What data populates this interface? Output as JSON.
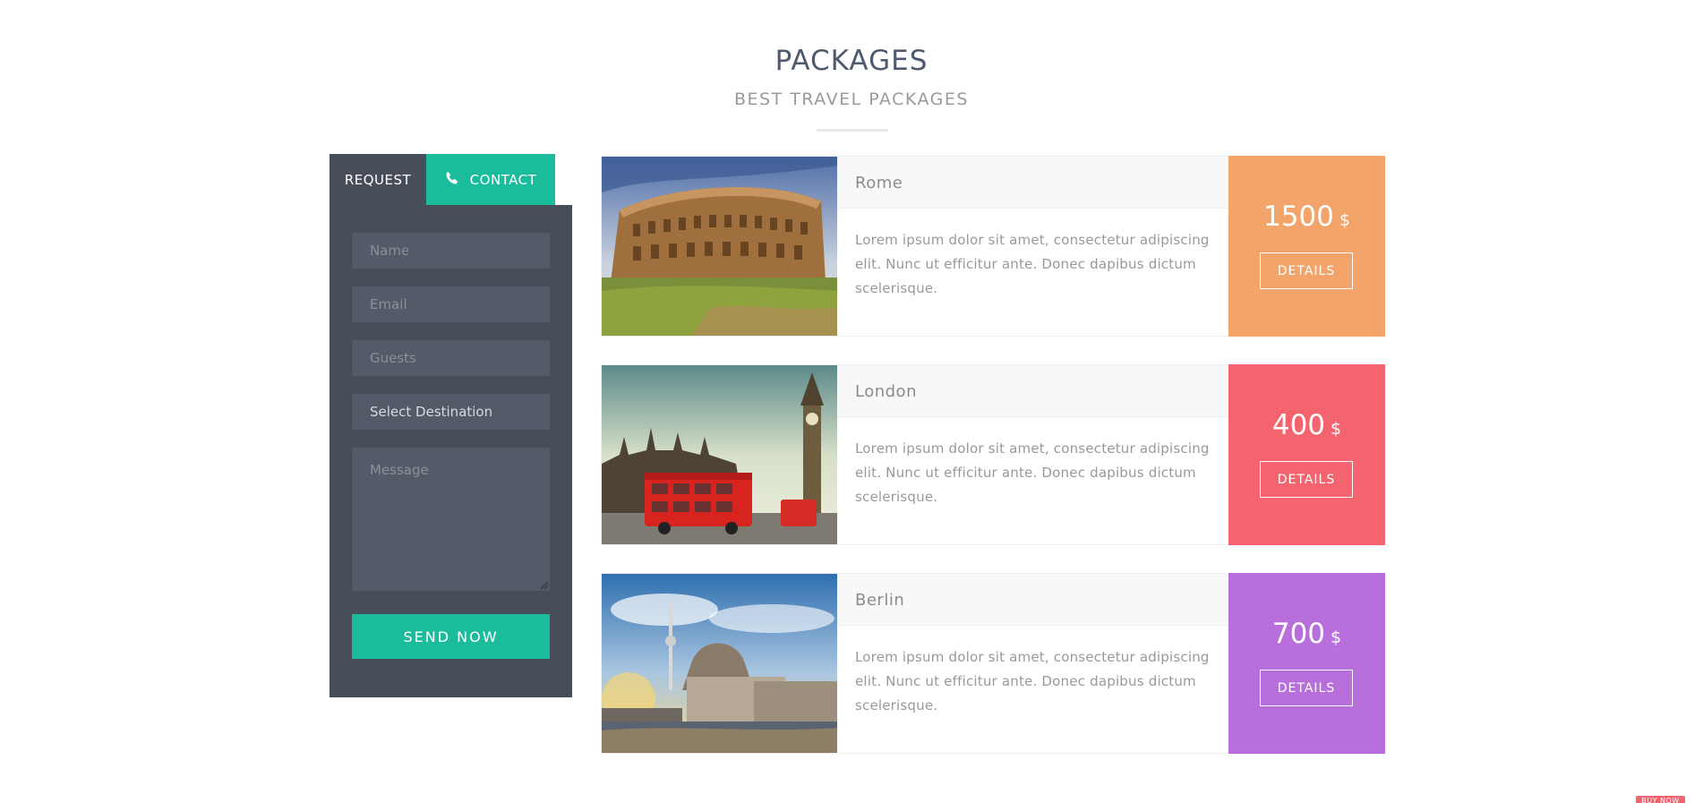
{
  "header": {
    "title": "PACKAGES",
    "subtitle": "BEST TRAVEL PACKAGES"
  },
  "form": {
    "tabs": {
      "request": "REQUEST",
      "contact": "CONTACT"
    },
    "name_placeholder": "Name",
    "email_placeholder": "Email",
    "guests_placeholder": "Guests",
    "destination_selected": "Select Destination",
    "message_placeholder": "Message",
    "submit_label": "SEND NOW"
  },
  "packages": [
    {
      "name": "Rome",
      "description": "Lorem ipsum dolor sit amet, consectetur adipiscing elit. Nunc ut efficitur ante. Donec dapibus dictum scelerisque.",
      "price": "1500",
      "currency": "$",
      "button": "DETAILS",
      "color": "#f2a46a"
    },
    {
      "name": "London",
      "description": "Lorem ipsum dolor sit amet, consectetur adipiscing elit. Nunc ut efficitur ante. Donec dapibus dictum scelerisque.",
      "price": "400",
      "currency": "$",
      "button": "DETAILS",
      "color": "#f4646f"
    },
    {
      "name": "Berlin",
      "description": "Lorem ipsum dolor sit amet, consectetur adipiscing elit. Nunc ut efficitur ante. Donec dapibus dictum scelerisque.",
      "price": "700",
      "currency": "$",
      "button": "DETAILS",
      "color": "#b86fdb"
    }
  ],
  "colors": {
    "accent": "#1abc9c",
    "panel": "#474e5a",
    "field": "#535b68",
    "title": "#4e5a6e"
  },
  "icons": {
    "contact": "phone-icon"
  },
  "corner_badge": "BUY NOW"
}
